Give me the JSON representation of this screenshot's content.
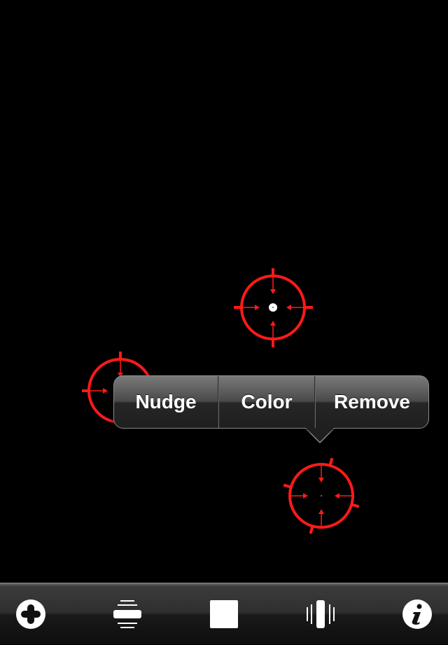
{
  "popup_menu": {
    "items": [
      {
        "label": "Nudge"
      },
      {
        "label": "Color"
      },
      {
        "label": "Remove"
      }
    ]
  },
  "reticles": [
    {
      "name": "crosshair-center",
      "color": "#ff0000",
      "center_dot": "white"
    },
    {
      "name": "crosshair-left",
      "color": "#ff0000"
    },
    {
      "name": "crosshair-rotated",
      "color": "#ff0000"
    }
  ],
  "toolbar": {
    "buttons": [
      {
        "icon": "add-icon"
      },
      {
        "icon": "horizontal-lines-icon"
      },
      {
        "icon": "square-icon"
      },
      {
        "icon": "vertical-lines-icon"
      },
      {
        "icon": "info-icon"
      }
    ]
  },
  "colors": {
    "reticle": "#ff0000",
    "background": "#000000"
  }
}
